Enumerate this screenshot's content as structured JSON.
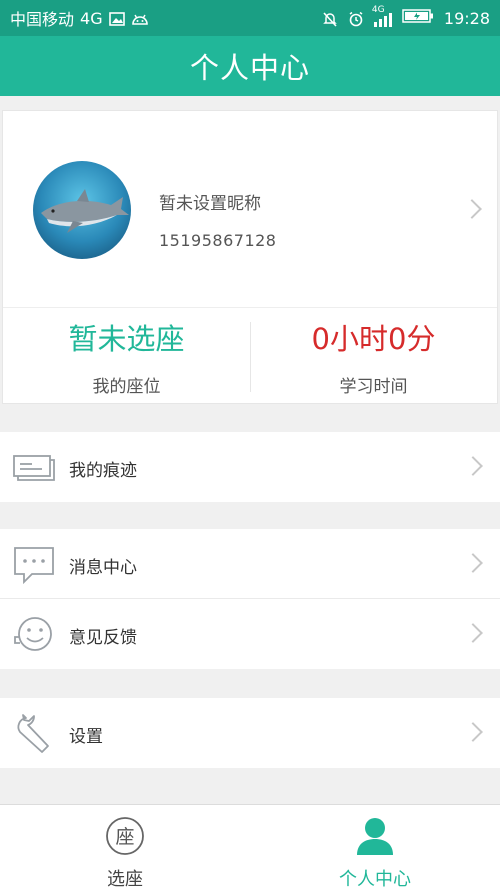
{
  "status_bar": {
    "carrier": "中国移动",
    "network": "4G",
    "signal_label": "4G",
    "time": "19:28"
  },
  "header": {
    "title": "个人中心"
  },
  "profile": {
    "nickname": "暂未设置昵称",
    "phone": "15195867128"
  },
  "stats": {
    "seat_value": "暂未选座",
    "seat_label": "我的座位",
    "time_value": "0小时0分",
    "time_label": "学习时间"
  },
  "menu": {
    "traces": "我的痕迹",
    "messages": "消息中心",
    "feedback": "意见反馈",
    "settings": "设置"
  },
  "tabbar": {
    "seat_tab": "选座",
    "seat_icon_glyph": "座",
    "profile_tab": "个人中心"
  },
  "colors": {
    "accent": "#21b799",
    "status_bar": "#1a9f84",
    "time_value": "#d62b2b"
  }
}
